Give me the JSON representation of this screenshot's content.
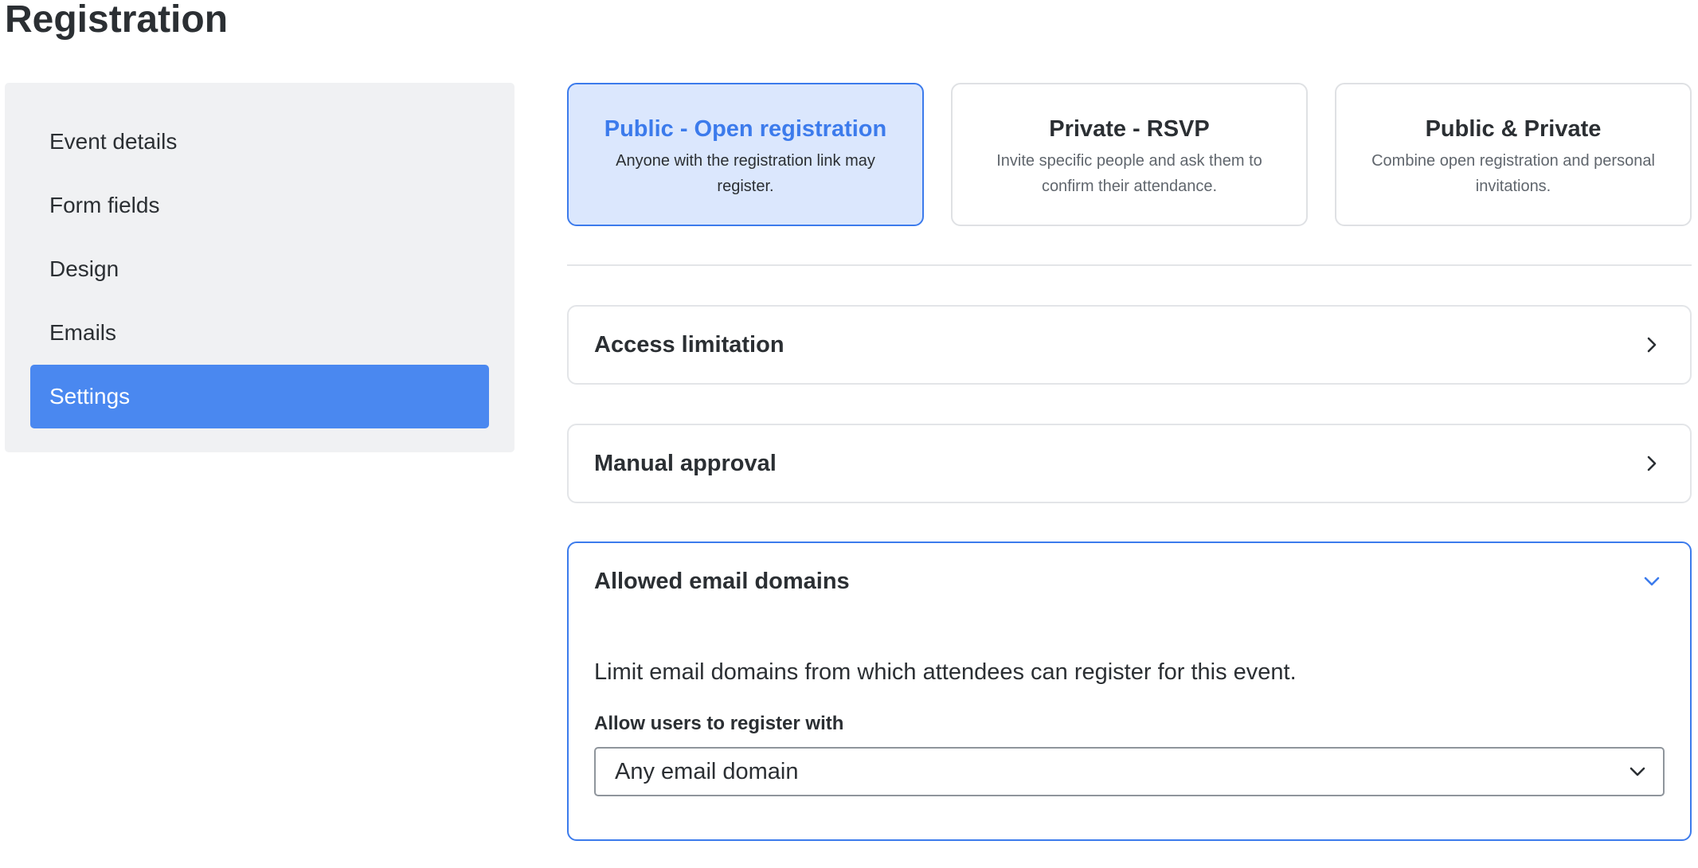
{
  "page": {
    "title": "Registration"
  },
  "sidebar": {
    "items": [
      {
        "label": "Event details",
        "active": false
      },
      {
        "label": "Form fields",
        "active": false
      },
      {
        "label": "Design",
        "active": false
      },
      {
        "label": "Emails",
        "active": false
      },
      {
        "label": "Settings",
        "active": true
      }
    ]
  },
  "registration_types": [
    {
      "title": "Public - Open registration",
      "description": "Anyone with the registration link may register.",
      "selected": true
    },
    {
      "title": "Private - RSVP",
      "description": "Invite specific people and ask them to confirm their attendance.",
      "selected": false
    },
    {
      "title": "Public & Private",
      "description": "Combine open registration and personal invitations.",
      "selected": false
    }
  ],
  "accordions": [
    {
      "title": "Access limitation",
      "expanded": false,
      "icon": "chevron-right-icon"
    },
    {
      "title": "Manual approval",
      "expanded": false,
      "icon": "chevron-right-icon"
    },
    {
      "title": "Allowed email domains",
      "expanded": true,
      "icon": "chevron-down-icon",
      "description": "Limit email domains from which attendees can register for this event.",
      "field_label": "Allow users to register with",
      "select_value": "Any email domain"
    }
  ],
  "colors": {
    "accent": "#4a88f0",
    "selected_card_bg": "#dbe7fd",
    "selected_border": "#3c7bec",
    "sidebar_bg": "#f0f1f3",
    "text": "#2b2f33"
  }
}
